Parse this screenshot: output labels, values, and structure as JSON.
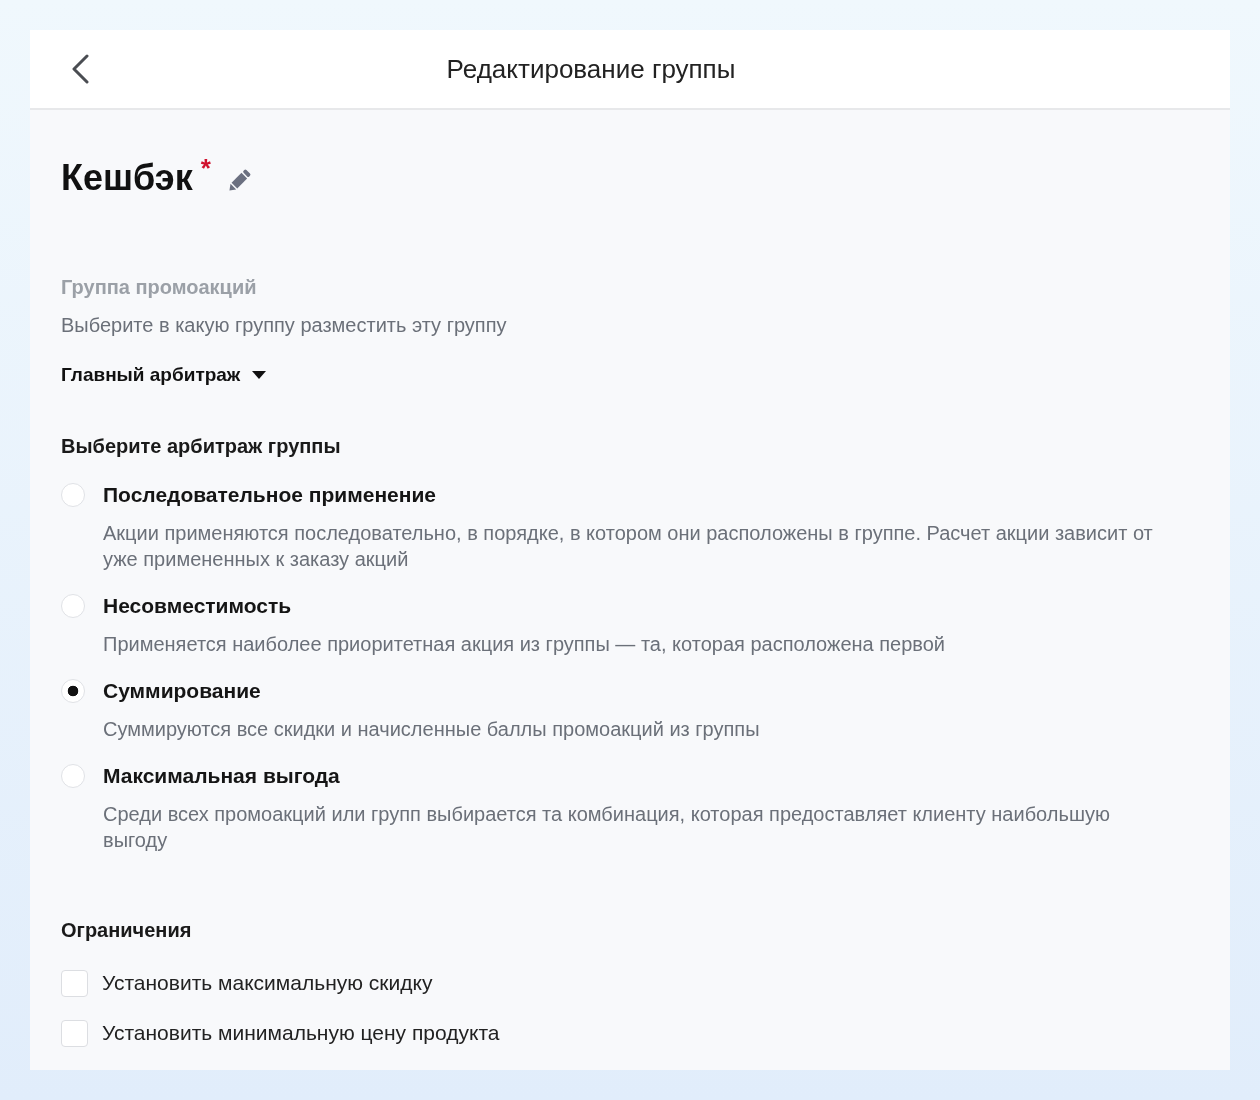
{
  "header": {
    "title": "Редактирование группы"
  },
  "group": {
    "name": "Кешбэк",
    "required_mark": "*"
  },
  "parent_group": {
    "label": "Группа промоакций",
    "hint": "Выберите в какую группу разместить эту группу",
    "value": "Главный арбитраж"
  },
  "arbitration": {
    "title": "Выберите арбитраж группы",
    "options": [
      {
        "label": "Последовательное применение",
        "description": "Акции применяются последовательно, в порядке, в котором они расположены в группе. Расчет акции зависит от уже примененных к заказу акций",
        "selected": false
      },
      {
        "label": "Несовместимость",
        "description": "Применяется наиболее приоритетная акция из группы — та, которая расположена первой",
        "selected": false
      },
      {
        "label": "Суммирование",
        "description": "Суммируются все скидки и начисленные баллы промоакций из группы",
        "selected": true
      },
      {
        "label": "Максимальная выгода",
        "description": "Среди всех промоакций или групп выбирается та комбинация, которая предоставляет клиенту наибольшую выгоду",
        "selected": false
      }
    ]
  },
  "limits": {
    "title": "Ограничения",
    "options": [
      {
        "label": "Установить максимальную скидку",
        "checked": false
      },
      {
        "label": "Установить минимальную цену продукта",
        "checked": false
      }
    ]
  }
}
